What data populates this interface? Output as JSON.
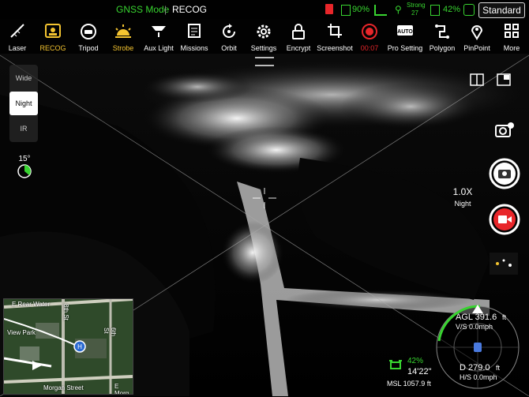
{
  "topbar": {
    "gnss_mode": "GNSS Mode",
    "separator": "|",
    "recog": "RECOG",
    "battery_drone": "90%",
    "signal_label": "Strong",
    "signal_value": "27",
    "battery_rc": "42%",
    "standard": "Standard"
  },
  "toolbar": [
    {
      "label": "Laser",
      "icon": "laser-icon",
      "active": false
    },
    {
      "label": "RECOG",
      "icon": "recog-icon",
      "active": true
    },
    {
      "label": "Tripod",
      "icon": "tripod-icon",
      "active": false
    },
    {
      "label": "Strobe",
      "icon": "strobe-icon",
      "active": true
    },
    {
      "label": "Aux Light",
      "icon": "aux-light-icon",
      "active": false
    },
    {
      "label": "Missions",
      "icon": "missions-icon",
      "active": false
    },
    {
      "label": "Orbit",
      "icon": "orbit-icon",
      "active": false
    },
    {
      "label": "Settings",
      "icon": "gear-icon",
      "active": false
    },
    {
      "label": "Encrypt",
      "icon": "lock-icon",
      "active": false
    },
    {
      "label": "Screenshot",
      "icon": "crop-icon",
      "active": false
    },
    {
      "label": "00:07",
      "icon": "record-icon",
      "active": false
    },
    {
      "label": "Pro Setting",
      "icon": "auto-icon",
      "active": false
    },
    {
      "label": "Polygon",
      "icon": "polygon-icon",
      "active": false
    },
    {
      "label": "PinPoint",
      "icon": "pin-icon",
      "active": false
    },
    {
      "label": "More",
      "icon": "grid-icon",
      "active": false
    }
  ],
  "modes": {
    "wide": "Wide",
    "night": "Night",
    "ir": "IR"
  },
  "gimbal": {
    "tilt": "15°"
  },
  "zoom": {
    "value": "1.0X",
    "mode": "Night"
  },
  "map": {
    "street1": "E Rear Water",
    "street2": "8th St",
    "street3": "View Park",
    "street4": "Morgan Street",
    "street5": "6th St",
    "street6": "E Morg"
  },
  "rc": {
    "battery": "42%",
    "flight_time": "14'22\"",
    "msl": "MSL 1057.9 ft"
  },
  "telemetry": {
    "agl": "AGL 391.6",
    "agl_unit": "ft",
    "vs": "V/S 0.0mph",
    "dist": "D 279.0",
    "dist_unit": "ft",
    "hs": "H/S 0.0mph"
  },
  "colors": {
    "accent": "#f4c430",
    "green": "#38d430",
    "record": "#e8262a"
  }
}
